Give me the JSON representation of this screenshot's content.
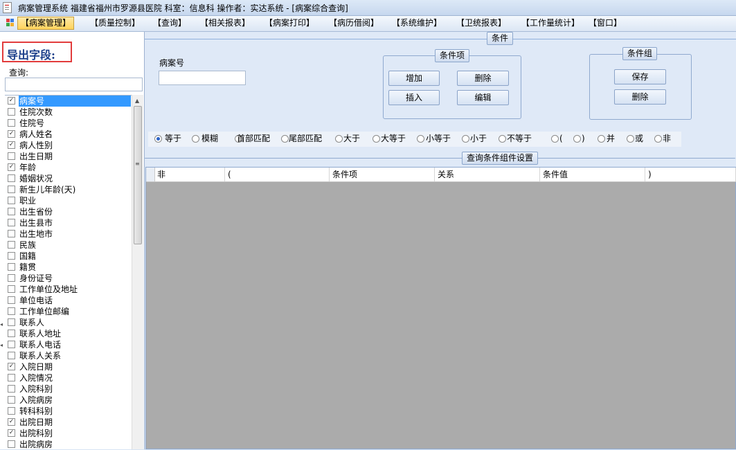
{
  "window": {
    "title": "病案管理系统  福建省福州市罗源县医院  科室：信息科  操作者：实达系统 - [病案综合查询]"
  },
  "menubar": {
    "items": [
      {
        "label": "【病案管理】",
        "active": true
      },
      {
        "label": "【质量控制】"
      },
      {
        "label": "【查询】"
      },
      {
        "label": "【相关报表】"
      },
      {
        "label": "【病案打印】"
      },
      {
        "label": "【病历借阅】"
      },
      {
        "label": "【系统维护】"
      },
      {
        "label": "【卫统报表】"
      },
      {
        "label": "【工作量统计】"
      },
      {
        "label": "【窗口】"
      }
    ]
  },
  "left": {
    "export_title": "导出字段:",
    "query_label": "查询:",
    "query_value": "",
    "fields": [
      {
        "label": "病案号",
        "checked": true,
        "selected": true
      },
      {
        "label": "住院次数",
        "checked": false
      },
      {
        "label": "住院号",
        "checked": false
      },
      {
        "label": "病人姓名",
        "checked": true
      },
      {
        "label": "病人性别",
        "checked": true
      },
      {
        "label": "出生日期",
        "checked": false
      },
      {
        "label": "年龄",
        "checked": true
      },
      {
        "label": "婚姻状况",
        "checked": false
      },
      {
        "label": "新生儿年龄(天)",
        "checked": false
      },
      {
        "label": "职业",
        "checked": false
      },
      {
        "label": "出生省份",
        "checked": false
      },
      {
        "label": "出生县市",
        "checked": false
      },
      {
        "label": "出生地市",
        "checked": false
      },
      {
        "label": "民族",
        "checked": false
      },
      {
        "label": "国籍",
        "checked": false
      },
      {
        "label": "籍贯",
        "checked": false
      },
      {
        "label": "身份证号",
        "checked": false
      },
      {
        "label": "工作单位及地址",
        "checked": false
      },
      {
        "label": "单位电话",
        "checked": false
      },
      {
        "label": "工作单位邮编",
        "checked": false
      },
      {
        "label": "联系人",
        "checked": false
      },
      {
        "label": "联系人地址",
        "checked": false
      },
      {
        "label": "联系人电话",
        "checked": false
      },
      {
        "label": "联系人关系",
        "checked": false
      },
      {
        "label": "入院日期",
        "checked": true
      },
      {
        "label": "入院情况",
        "checked": false
      },
      {
        "label": "入院科别",
        "checked": false
      },
      {
        "label": "入院病房",
        "checked": false
      },
      {
        "label": "转科科别",
        "checked": false
      },
      {
        "label": "出院日期",
        "checked": true
      },
      {
        "label": "出院科别",
        "checked": true
      },
      {
        "label": "出院病房",
        "checked": false
      }
    ]
  },
  "conditions": {
    "legend": "条件",
    "field_label": "病案号",
    "field_value": "",
    "condition_item": {
      "legend": "条件项",
      "add": "增加",
      "delete": "删除",
      "insert": "插入",
      "edit": "编辑"
    },
    "condition_group": {
      "legend": "条件组",
      "save": "保存",
      "delete": "删除"
    },
    "operators": [
      {
        "label": "等于",
        "selected": true
      },
      {
        "label": "模糊"
      },
      {
        "label": "首部匹配"
      },
      {
        "label": "尾部匹配"
      },
      {
        "label": "大于"
      },
      {
        "label": "大等于"
      },
      {
        "label": "小等于"
      },
      {
        "label": "小于"
      },
      {
        "label": "不等于"
      },
      {
        "label": "("
      },
      {
        "label": ")"
      },
      {
        "label": "并"
      },
      {
        "label": "或"
      },
      {
        "label": "非"
      }
    ]
  },
  "grid": {
    "legend": "查询条件组件设置",
    "columns": [
      "非",
      "(",
      "条件项",
      "关系",
      "条件值",
      ")"
    ]
  }
}
